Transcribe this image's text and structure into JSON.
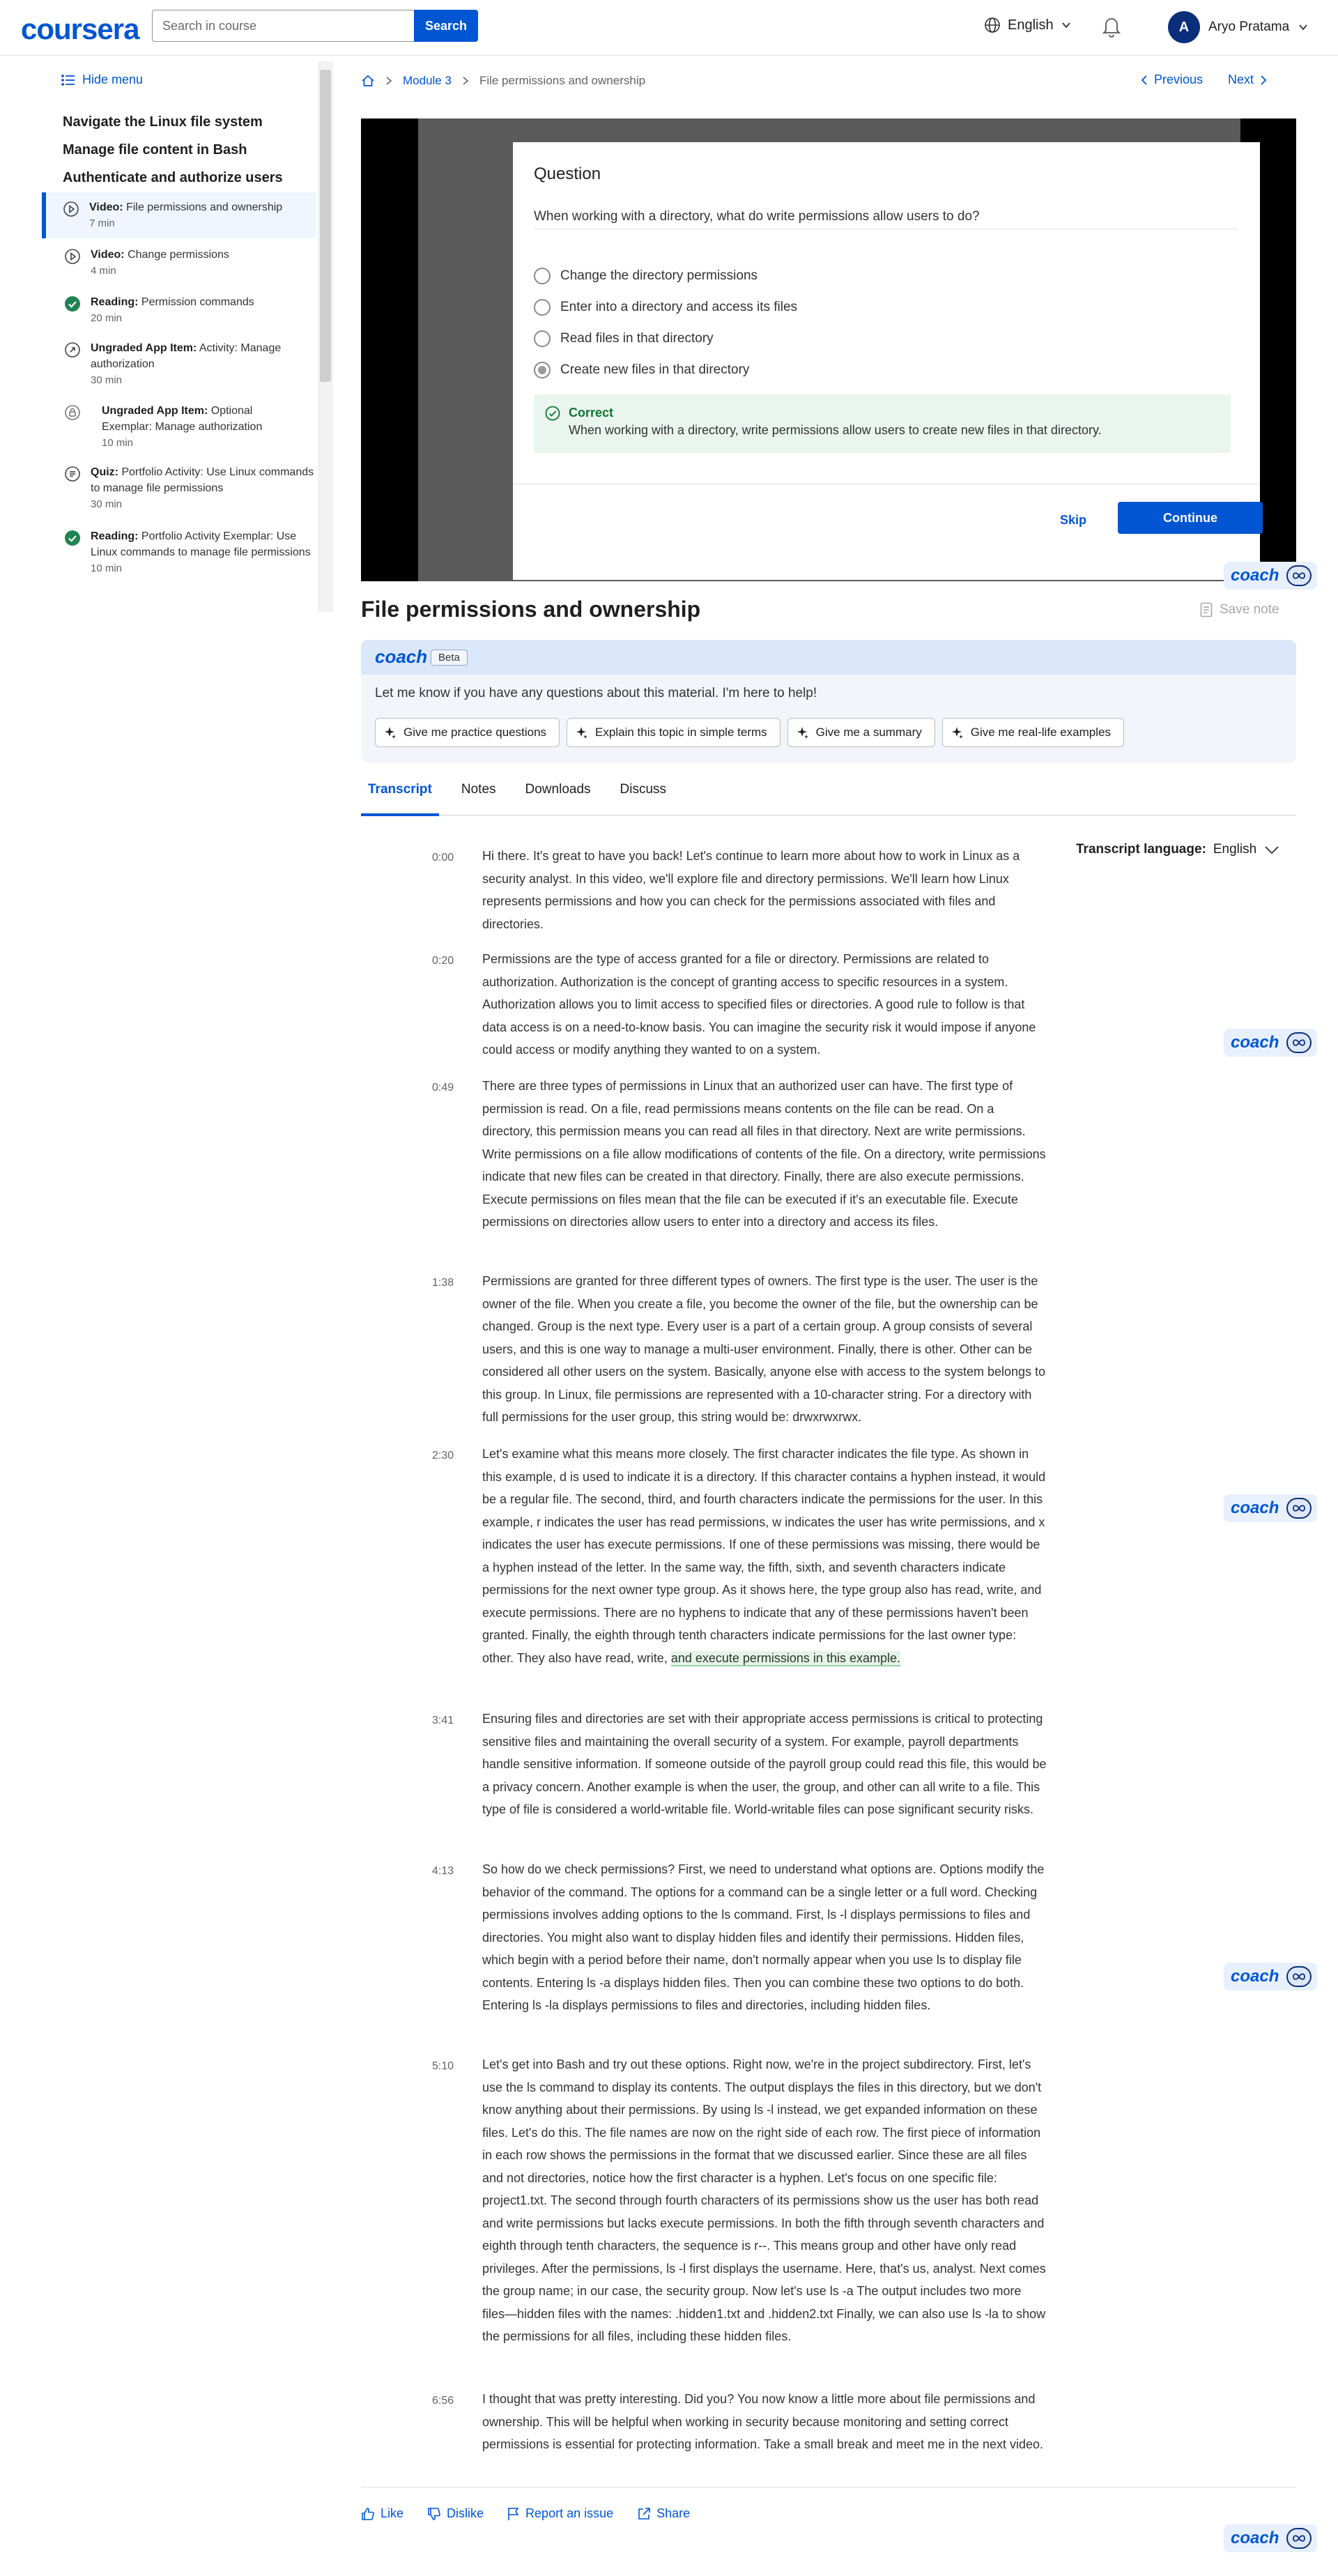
{
  "header": {
    "logo": "coursera",
    "search_placeholder": "Search in course",
    "search_button": "Search",
    "language": "English",
    "user_initial": "A",
    "user_name": "Aryo Pratama"
  },
  "sidebar": {
    "hide_menu": "Hide menu",
    "modules": [
      "Navigate the Linux file system",
      "Manage file content in Bash",
      "Authenticate and authorize users"
    ],
    "items": [
      {
        "kind": "Video:",
        "title": "File permissions and ownership",
        "duration": "7 min",
        "icon": "play-circle-icon"
      },
      {
        "kind": "Video:",
        "title": "Change permissions",
        "duration": "4 min",
        "icon": "play-circle-icon"
      },
      {
        "kind": "Reading:",
        "title": "Permission commands",
        "duration": "20 min",
        "icon": "check-circle-icon"
      },
      {
        "kind": "Ungraded App Item:",
        "title": "Activity: Manage authorization",
        "duration": "30 min",
        "icon": "app-item-icon"
      },
      {
        "kind": "Ungraded App Item:",
        "title": "Optional Exemplar: Manage authorization",
        "duration": "10 min",
        "icon": "lock-icon"
      },
      {
        "kind": "Quiz:",
        "title": "Portfolio Activity: Use Linux commands to manage file permissions",
        "duration": "30 min",
        "icon": "quiz-icon"
      },
      {
        "kind": "Reading:",
        "title": "Portfolio Activity Exemplar: Use Linux commands to manage file permissions",
        "duration": "10 min",
        "icon": "check-circle-icon"
      }
    ]
  },
  "breadcrumb": {
    "module": "Module 3",
    "current": "File permissions and ownership",
    "previous": "Previous",
    "next": "Next"
  },
  "question": {
    "title": "Question",
    "prompt": "When working with a directory, what do write permissions allow users to do?",
    "options": [
      "Change the directory permissions",
      "Enter into a directory and access its files",
      "Read files in that directory",
      "Create new files in that directory"
    ],
    "selected_index": 3,
    "feedback_title": "Correct",
    "feedback_body": "When working with a directory, write permissions allow users to create new files in that directory.",
    "skip": "Skip",
    "continue": "Continue"
  },
  "coach_word": "coach",
  "page_title": "File permissions and ownership",
  "save_note": "Save note",
  "coach_panel": {
    "title": "coach",
    "badge": "Beta",
    "message": "Let me know if you have any questions about this material. I'm here to help!",
    "chips": [
      "Give me practice questions",
      "Explain this topic in simple terms",
      "Give me a summary",
      "Give me real-life examples"
    ]
  },
  "tabs": [
    "Transcript",
    "Notes",
    "Downloads",
    "Discuss"
  ],
  "transcript": {
    "language_label": "Transcript language:",
    "language_value": "English",
    "paragraphs": [
      {
        "time": "0:00",
        "text": "Hi there. It's great to have you back! Let's continue to learn more about how to work in Linux as a security analyst. In this video, we'll explore file and directory permissions. We'll learn how Linux represents permissions and how you can check for the permissions associated with files and directories."
      },
      {
        "time": "0:20",
        "text": "Permissions are the type of access granted for a file or directory. Permissions are related to authorization. Authorization is the concept of granting access to specific resources in a system. Authorization allows you to limit access to specified files or directories. A good rule to follow is that data access is on a need-to-know basis. You can imagine the security risk it would impose if anyone could access or modify anything they wanted to on a system."
      },
      {
        "time": "0:49",
        "text": "There are three types of permissions in Linux that an authorized user can have. The first type of permission is read. On a file, read permissions means contents on the file can be read. On a directory, this permission means you can read all files in that directory. Next are write permissions. Write permissions on a file allow modifications of contents of the file. On a directory, write permissions indicate that new files can be created in that directory. Finally, there are also execute permissions. Execute permissions on files mean that the file can be executed if it's an executable file. Execute permissions on directories allow users to enter into a directory and access its files."
      },
      {
        "time": "1:38",
        "text": "Permissions are granted for three different types of owners. The first type is the user. The user is the owner of the file. When you create a file, you become the owner of the file, but the ownership can be changed. Group is the next type. Every user is a part of a certain group. A group consists of several users, and this is one way to manage a multi-user environment. Finally, there is other. Other can be considered all other users on the system. Basically, anyone else with access to the system belongs to this group. In Linux, file permissions are represented with a 10-character string. For a directory with full permissions for the user group, this string would be: drwxrwxrwx."
      },
      {
        "time": "2:30",
        "text": "Let's examine what this means more closely. The first character indicates the file type. As shown in this example, d is used to indicate it is a directory. If this character contains a hyphen instead, it would be a regular file. The second, third, and fourth characters indicate the permissions for the user. In this example, r indicates the user has read permissions, w indicates the user has write permissions, and x indicates the user has execute permissions. If one of these permissions was missing, there would be a hyphen instead of the letter. In the same way, the fifth, sixth, and seventh characters indicate permissions for the next owner type group. As it shows here, the type group also has read, write, and execute permissions. There are no hyphens to indicate that any of these permissions haven't been granted. Finally, the eighth through tenth characters indicate permissions for the last owner type: other. They also have read, write, ",
        "highlight": "and execute permissions in this example."
      },
      {
        "time": "3:41",
        "text": "Ensuring files and directories are set with their appropriate access permissions is critical to protecting sensitive files and maintaining the overall security of a system. For example, payroll departments handle sensitive information. If someone outside of the payroll group could read this file, this would be a privacy concern. Another example is when the user, the group, and other can all write to a file. This type of file is considered a world-writable file. World-writable files can pose significant security risks."
      },
      {
        "time": "4:13",
        "text": "So how do we check permissions? First, we need to understand what options are. Options modify the behavior of the command. The options for a command can be a single letter or a full word. Checking permissions involves adding options to the ls command. First, ls -l displays permissions to files and directories. You might also want to display hidden files and identify their permissions. Hidden files, which begin with a period before their name, don't normally appear when you use ls to display file contents. Entering ls -a displays hidden files. Then you can combine these two options to do both. Entering ls -la displays permissions to files and directories, including hidden files."
      },
      {
        "time": "5:10",
        "text": "Let's get into Bash and try out these options. Right now, we're in the project subdirectory. First, let's use the ls command to display its contents. The output displays the files in this directory, but we don't know anything about their permissions. By using ls -l instead, we get expanded information on these files. Let's do this. The file names are now on the right side of each row. The first piece of information in each row shows the permissions in the format that we discussed earlier. Since these are all files and not directories, notice how the first character is a hyphen. Let's focus on one specific file: project1.txt. The second through fourth characters of its permissions show us the user has both read and write permissions but lacks execute permissions. In both the fifth through seventh characters and eighth through tenth characters, the sequence is r--. This means group and other have only read privileges. After the permissions, ls -l first displays the username. Here, that's us, analyst. Next comes the group name; in our case, the security group. Now let's use ls -a The output includes two more files—hidden files with the names: .hidden1.txt and .hidden2.txt Finally, we can also use ls -la to show the permissions for all files, including these hidden files."
      },
      {
        "time": "6:56",
        "text": "I thought that was pretty interesting. Did you? You now know a little more about file permissions and ownership. This will be helpful when working in security because monitoring and setting correct permissions is essential for protecting information. Take a small break and meet me in the next video."
      }
    ]
  },
  "actions": [
    "Like",
    "Dislike",
    "Report an issue",
    "Share"
  ],
  "colors": {
    "brand": "#0056d2",
    "correct": "#137333",
    "feedback_bg": "#e9f5ee"
  }
}
